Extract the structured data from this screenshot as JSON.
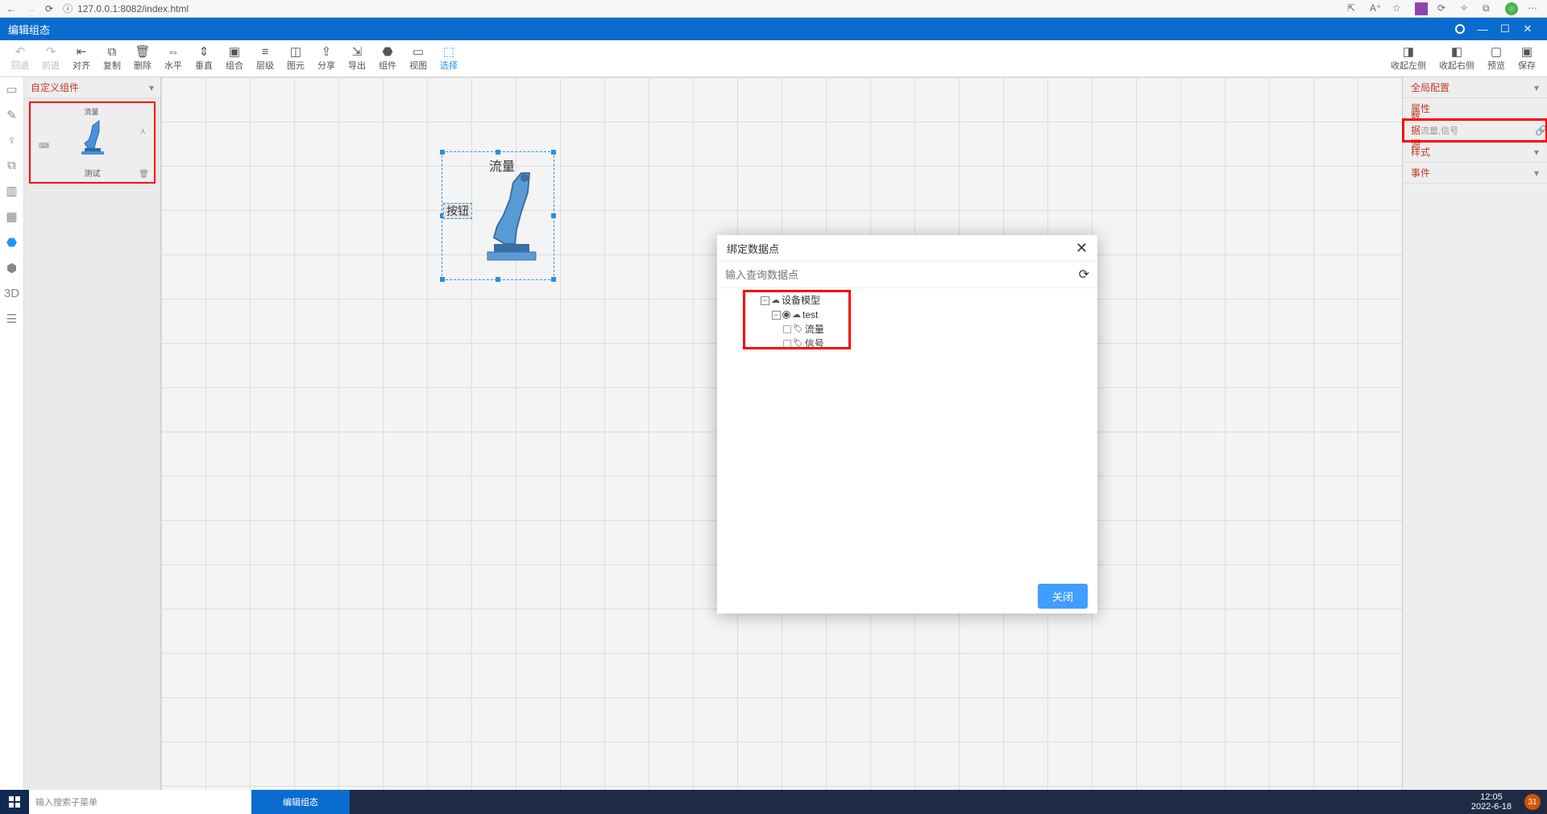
{
  "browser": {
    "url": "127.0.0.1:8082/index.html"
  },
  "titleBar": {
    "title": "编辑组态",
    "minus": "—",
    "square": "☐",
    "close": "✕"
  },
  "toolbar": {
    "undo": "回退",
    "redo": "前进",
    "align": "对齐",
    "copy": "复制",
    "delete": "删除",
    "horiz": "水平",
    "vert": "垂直",
    "group": "组合",
    "layer": "层级",
    "primitive": "图元",
    "share": "分享",
    "export": "导出",
    "component": "组件",
    "view": "视图",
    "select": "选择",
    "collapseLeft": "收起左侧",
    "collapseRight": "收起右侧",
    "preview": "预览",
    "save": "保存"
  },
  "leftPanel": {
    "header": "自定义组件",
    "thumb": {
      "topLabel": "流量",
      "name": "测试"
    }
  },
  "canvas": {
    "flowLabel": "流量",
    "buttonLabel": "按钮"
  },
  "rightPanel": {
    "global": "全局配置",
    "attrs": "属性",
    "dataSource": {
      "label": "数据源",
      "value": "流量,信号"
    },
    "style": "样式",
    "event": "事件"
  },
  "modal": {
    "title": "绑定数据点",
    "searchPlaceholder": "输入查询数据点",
    "tree": {
      "root": "设备模型",
      "child": "test",
      "leaf1": "流量",
      "leaf2": "信号"
    },
    "closeBtn": "关闭"
  },
  "taskbar": {
    "searchPlaceholder": "输入搜索子菜单",
    "app": "编辑组态",
    "time": "12:05",
    "date": "2022-6-18",
    "badge": "31"
  }
}
